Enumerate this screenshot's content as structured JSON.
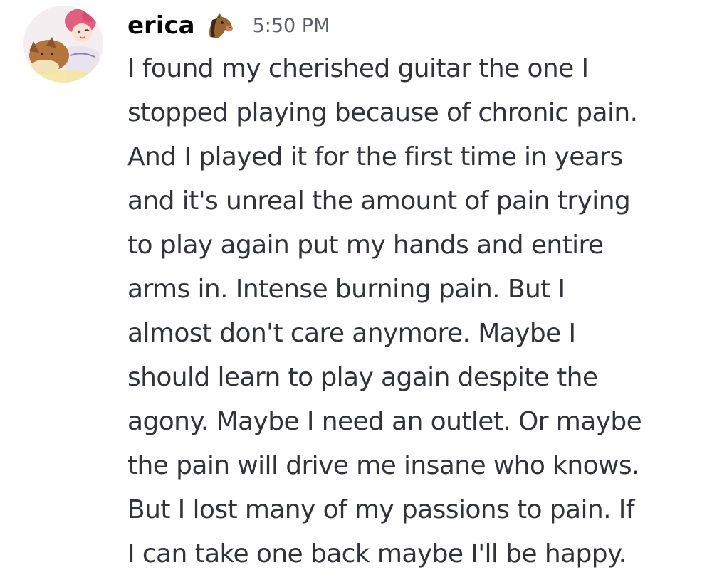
{
  "message": {
    "author": "erica",
    "timestamp": "5:50 PM",
    "role_icon": "horse-face-emoji",
    "lines": [
      "I found my cherished guitar the one I",
      "stopped playing because of chronic pain.",
      "And I played it for the first time in years",
      "and it's unreal the amount of pain trying",
      "to play again put my hands and entire",
      "arms in. Intense burning pain. But I",
      "almost don't care anymore. Maybe I",
      "should learn to play again despite the",
      "agony. Maybe I need an outlet. Or maybe",
      "the pain will drive me insane who knows.",
      "But I lost many of my passions to pain. If",
      "I can take one back maybe I'll be happy."
    ]
  },
  "colors": {
    "background": "#ffffff",
    "username": "#060607",
    "timestamp": "#5c5e66",
    "text": "#313338"
  }
}
